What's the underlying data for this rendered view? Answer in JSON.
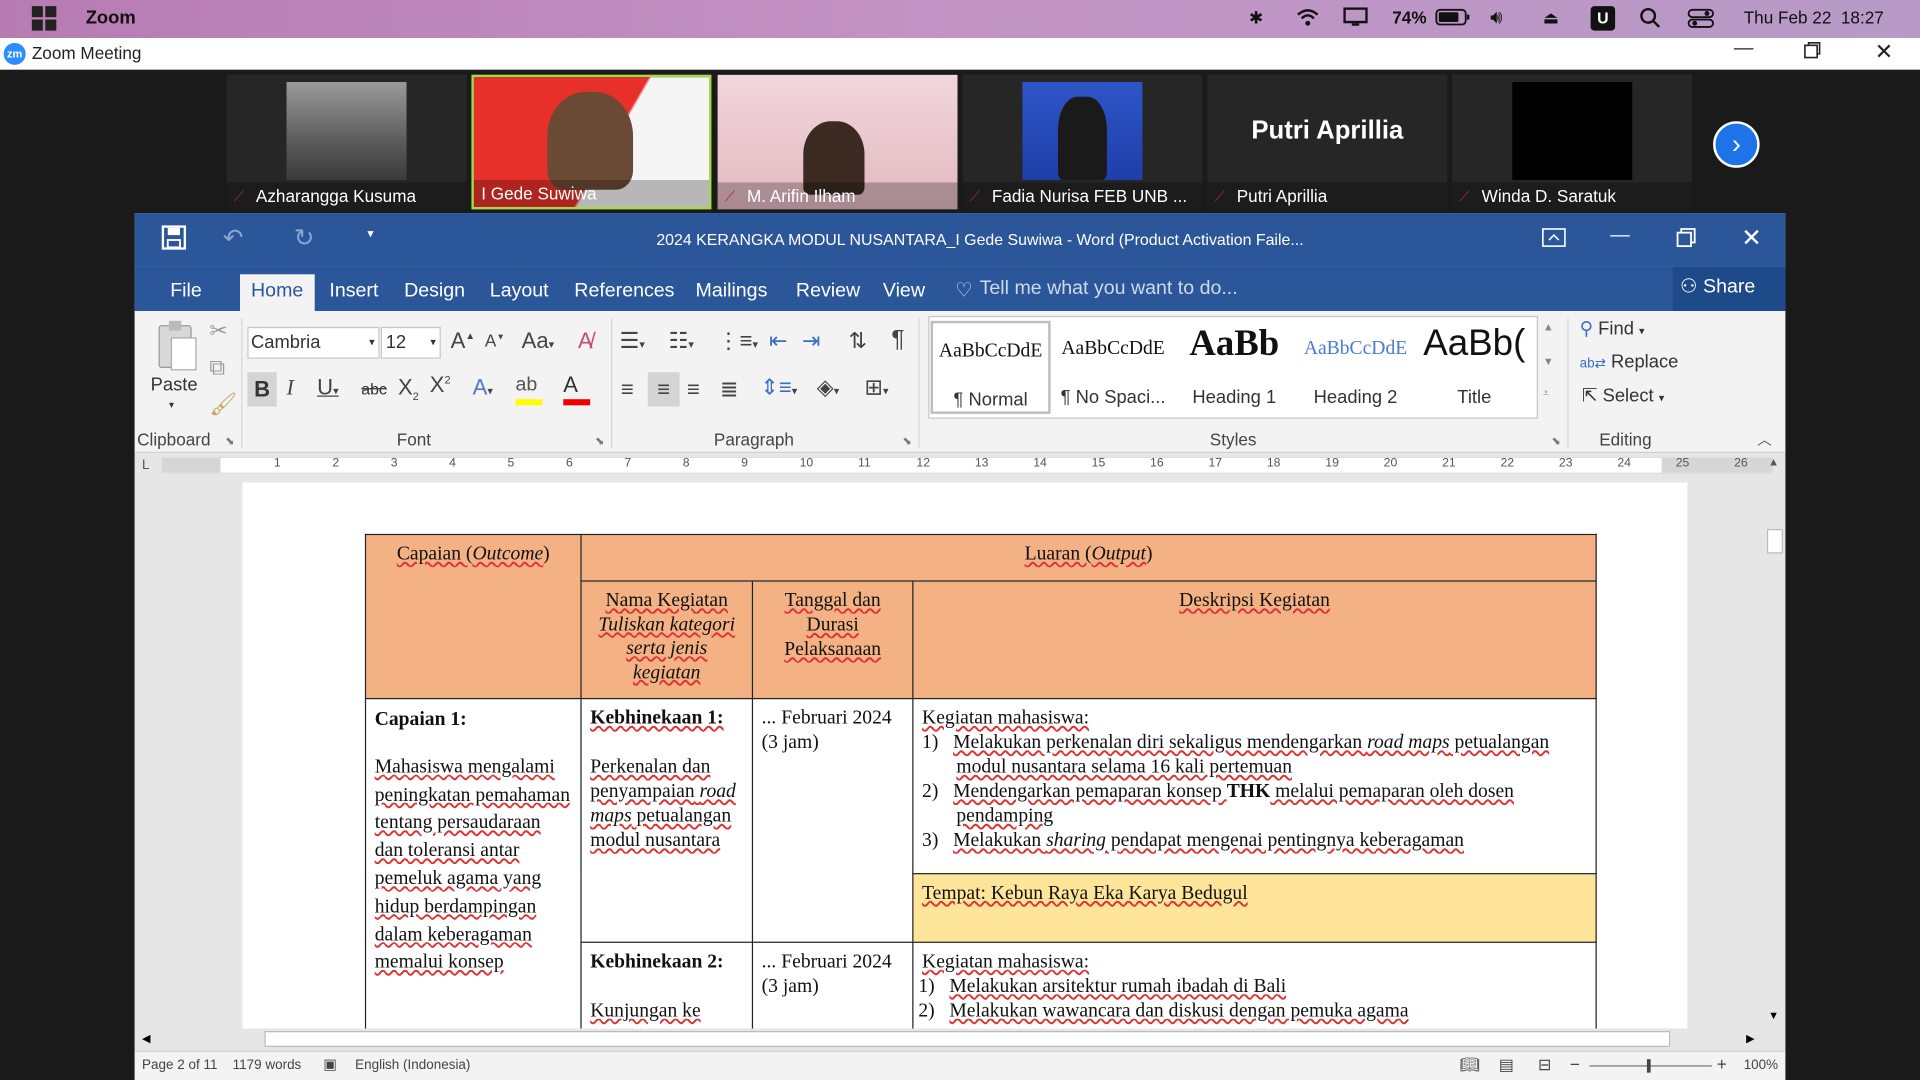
{
  "menubar": {
    "app_name": "Zoom",
    "battery": "74%",
    "datetime": "Thu Feb 22  18:27",
    "user_badge": "U",
    "color": "#c394c4"
  },
  "zoom_window": {
    "title": "Zoom Meeting",
    "logo": "zm"
  },
  "participants": [
    {
      "name": "Azharangga Kusuma",
      "muted": true
    },
    {
      "name": "I Gede Suwiwa",
      "muted": false,
      "active": true
    },
    {
      "name": "M. Arifin Ilham",
      "muted": true
    },
    {
      "name": "Fadia Nurisa FEB UNB ...",
      "muted": true
    },
    {
      "name": "Putri Aprillia",
      "muted": true,
      "big_name": "Putri Aprillia"
    },
    {
      "name": "Winda D. Saratuk",
      "muted": true
    }
  ],
  "word": {
    "title": "2024 KERANGKA MODUL NUSANTARA_I Gede Suwiwa - Word (Product Activation Faile...",
    "accent": "#2b579a",
    "tabs": [
      "File",
      "Home",
      "Insert",
      "Design",
      "Layout",
      "References",
      "Mailings",
      "Review",
      "View"
    ],
    "active_tab": "Home",
    "tell_me": "Tell me what you want to do...",
    "share": "Share",
    "font": {
      "name": "Cambria",
      "size": "12"
    },
    "paste": "Paste",
    "groups": {
      "clipboard": "Clipboard",
      "font": "Font",
      "paragraph": "Paragraph",
      "styles": "Styles",
      "editing": "Editing"
    },
    "styles": [
      {
        "preview": "AaBbCcDdE",
        "name": "¶ Normal"
      },
      {
        "preview": "AaBbCcDdE",
        "name": "¶ No Spaci..."
      },
      {
        "preview": "AaBb",
        "name": "Heading 1"
      },
      {
        "preview": "AaBbCcDdE",
        "name": "Heading 2"
      },
      {
        "preview": "AaBb(",
        "name": "Title"
      }
    ],
    "editing": {
      "find": "Find",
      "replace": "Replace",
      "select": "Select"
    },
    "ruler_marks": [
      "1",
      "2",
      "3",
      "4",
      "5",
      "6",
      "7",
      "8",
      "9",
      "10",
      "11",
      "12",
      "13",
      "14",
      "15",
      "16",
      "17",
      "18",
      "19",
      "20",
      "21",
      "22",
      "23",
      "24",
      "25",
      "26"
    ],
    "status": {
      "page": "Page 2 of 11",
      "words": "1179 words",
      "language": "English (Indonesia)",
      "zoom": "100%"
    }
  },
  "document": {
    "h_capaian": "Capaian (",
    "h_capaian_it": "Outcome",
    "h_luaran": "Luaran (",
    "h_luaran_it": "Output",
    "h_nama": "Nama Kegiatan",
    "h_nama_it": "Tuliskan kategori serta jenis kegiatan",
    "h_tanggal": "Tanggal dan Durasi Pelaksanaan",
    "h_deskripsi": "Deskripsi Kegiatan",
    "capaian1_title": "Capaian 1:",
    "capaian1_text": "Mahasiswa mengalami peningkatan pemahaman tentang persaudaraan dan toleransi antar pemeluk agama yang hidup berdampingan dalam keberagaman memalui konsep",
    "keb1_title": "Kebhinekaan 1:",
    "keb1_text_a": "Perkenalan dan penyampaian",
    "keb1_text_it": "road maps",
    "keb1_text_b": "petualangan modul nusantara",
    "date1": "... Februari 2024 (3 jam)",
    "desc1_intro": "Kegiatan mahasiswa:",
    "desc1_items": [
      {
        "n": "1)",
        "a": "Melakukan perkenalan diri sekaligus mendengarkan ",
        "it": "road maps",
        "b": " petualangan modul nusantara selama 16 kali pertemuan"
      },
      {
        "n": "2)",
        "a": "Mendengarkan pemaparan konsep ",
        "bold": "THK",
        "b": " melalui pemaparan oleh dosen pendamping"
      },
      {
        "n": "3)",
        "a": "Melakukan ",
        "it": "sharing",
        "b": " pendapat mengenai pentingnya keberagaman"
      }
    ],
    "tempat": "Tempat: Kebun Raya Eka Karya Bedugul",
    "keb2_title": "Kebhinekaan 2:",
    "keb2_text": "Kunjungan ke",
    "date2": "... Februari 2024 (3 jam)",
    "desc2_intro": "Kegiatan mahasiswa:",
    "desc2_items": [
      {
        "n": "1)",
        "a": "Melakukan arsitektur rumah ibadah di Bali"
      },
      {
        "n": "2)",
        "a": "Melakukan wawancara dan diskusi dengan pemuka agama"
      }
    ]
  }
}
